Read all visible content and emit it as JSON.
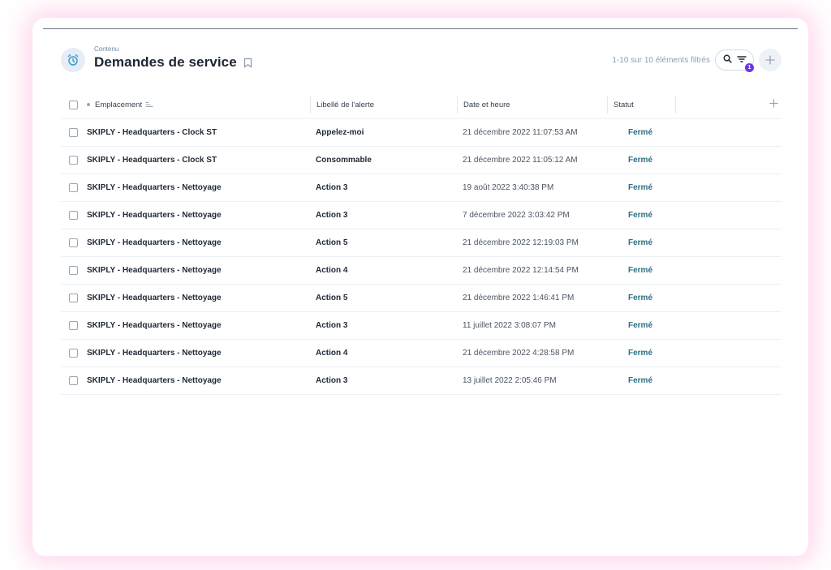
{
  "header": {
    "breadcrumb": "Contenu",
    "title": "Demandes de service",
    "count_text": "1-10 sur 10 éléments filtrés",
    "filter_badge": "1"
  },
  "columns": {
    "location": "Emplacement",
    "alert_label": "Libellé de l'alerte",
    "datetime": "Date et heure",
    "status": "Statut"
  },
  "rows": [
    {
      "location": "SKIPLY - Headquarters - Clock ST",
      "label": "Appelez-moi",
      "datetime": "21 décembre 2022 11:07:53 AM",
      "status": "Fermé"
    },
    {
      "location": "SKIPLY - Headquarters - Clock ST",
      "label": "Consommable",
      "datetime": "21 décembre 2022 11:05:12 AM",
      "status": "Fermé"
    },
    {
      "location": "SKIPLY - Headquarters - Nettoyage",
      "label": "Action 3",
      "datetime": "19 août 2022 3:40:38 PM",
      "status": "Fermé"
    },
    {
      "location": "SKIPLY - Headquarters - Nettoyage",
      "label": "Action 3",
      "datetime": "7 décembre 2022 3:03:42 PM",
      "status": "Fermé"
    },
    {
      "location": "SKIPLY - Headquarters - Nettoyage",
      "label": "Action 5",
      "datetime": "21 décembre 2022 12:19:03 PM",
      "status": "Fermé"
    },
    {
      "location": "SKIPLY - Headquarters - Nettoyage",
      "label": "Action 4",
      "datetime": "21 décembre 2022 12:14:54 PM",
      "status": "Fermé"
    },
    {
      "location": "SKIPLY - Headquarters - Nettoyage",
      "label": "Action 5",
      "datetime": "21 décembre 2022 1:46:41 PM",
      "status": "Fermé"
    },
    {
      "location": "SKIPLY - Headquarters - Nettoyage",
      "label": "Action 3",
      "datetime": "11 juillet 2022 3:08:07 PM",
      "status": "Fermé"
    },
    {
      "location": "SKIPLY - Headquarters - Nettoyage",
      "label": "Action 4",
      "datetime": "21 décembre 2022 4:28:58 PM",
      "status": "Fermé"
    },
    {
      "location": "SKIPLY - Headquarters - Nettoyage",
      "label": "Action 3",
      "datetime": "13 juillet 2022 2:05:46 PM",
      "status": "Fermé"
    }
  ],
  "icons": {
    "app": "alarm-clock-icon",
    "bookmark": "bookmark-icon",
    "search": "search-icon",
    "filter": "filter-icon",
    "add": "plus-icon",
    "sort": "sort-icon"
  },
  "colors": {
    "status_closed": "#2b6f84",
    "badge": "#6d35e8",
    "border_top": "#6b6f86"
  }
}
